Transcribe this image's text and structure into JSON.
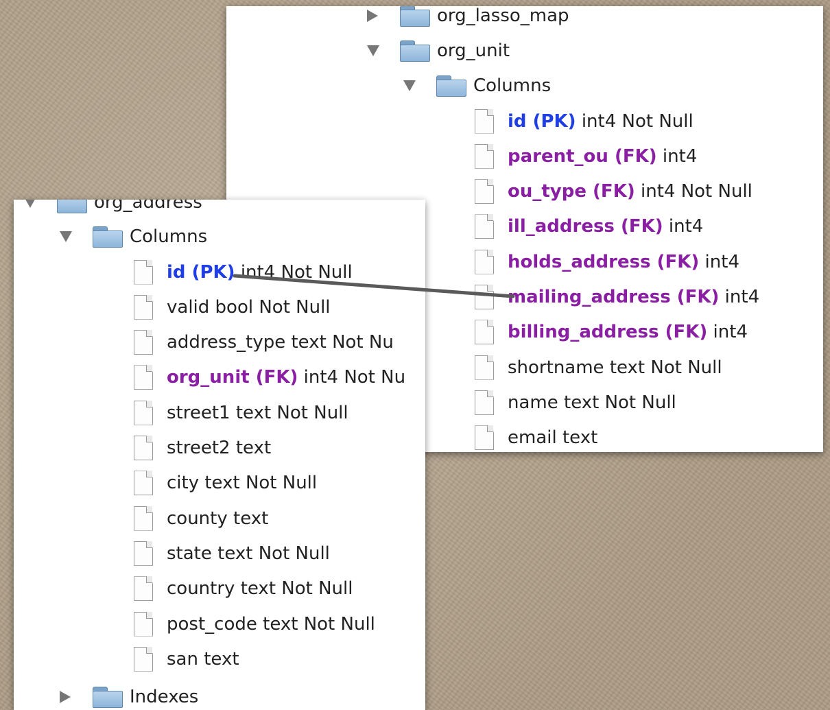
{
  "right_tree": {
    "tables": [
      {
        "name": "org_lasso_map",
        "expanded": false
      },
      {
        "name": "org_unit",
        "expanded": true
      }
    ],
    "columns_label": "Columns",
    "columns": [
      {
        "name": "id (PK)",
        "type": "int4 Not Null",
        "key": "pk"
      },
      {
        "name": "parent_ou (FK)",
        "type": "int4",
        "key": "fk"
      },
      {
        "name": "ou_type (FK)",
        "type": "int4 Not Null",
        "key": "fk"
      },
      {
        "name": "ill_address (FK)",
        "type": "int4",
        "key": "fk"
      },
      {
        "name": "holds_address (FK)",
        "type": "int4",
        "key": "fk"
      },
      {
        "name": "mailing_address (FK)",
        "type": "int4",
        "key": "fk"
      },
      {
        "name": "billing_address (FK)",
        "type": "int4",
        "key": "fk"
      },
      {
        "name": "",
        "type": "shortname text Not Null",
        "key": "none"
      },
      {
        "name": "",
        "type": "name text Not Null",
        "key": "none"
      },
      {
        "name": "",
        "type": "email text",
        "key": "none"
      }
    ]
  },
  "left_tree": {
    "table": {
      "name": "org_address",
      "expanded": true
    },
    "columns_label": "Columns",
    "columns": [
      {
        "name": "id (PK)",
        "type": "int4 Not Null",
        "key": "pk"
      },
      {
        "name": "",
        "type": "valid bool Not Null",
        "key": "none"
      },
      {
        "name": "",
        "type": "address_type text Not Nu",
        "key": "none"
      },
      {
        "name": "org_unit (FK)",
        "type": "int4 Not Nu",
        "key": "fk"
      },
      {
        "name": "",
        "type": "street1 text Not Null",
        "key": "none"
      },
      {
        "name": "",
        "type": "street2 text",
        "key": "none"
      },
      {
        "name": "",
        "type": "city text Not Null",
        "key": "none"
      },
      {
        "name": "",
        "type": "county text",
        "key": "none"
      },
      {
        "name": "",
        "type": "state text Not Null",
        "key": "none"
      },
      {
        "name": "",
        "type": "country text Not Null",
        "key": "none"
      },
      {
        "name": "",
        "type": "post_code text Not Null",
        "key": "none"
      },
      {
        "name": "",
        "type": "san text",
        "key": "none"
      }
    ],
    "indexes_label": "Indexes"
  },
  "colors": {
    "primary_key": "#1f3ee6",
    "foreign_key": "#8a1fa3",
    "connector": "#5a5a5a",
    "background": "#b5a58f"
  }
}
